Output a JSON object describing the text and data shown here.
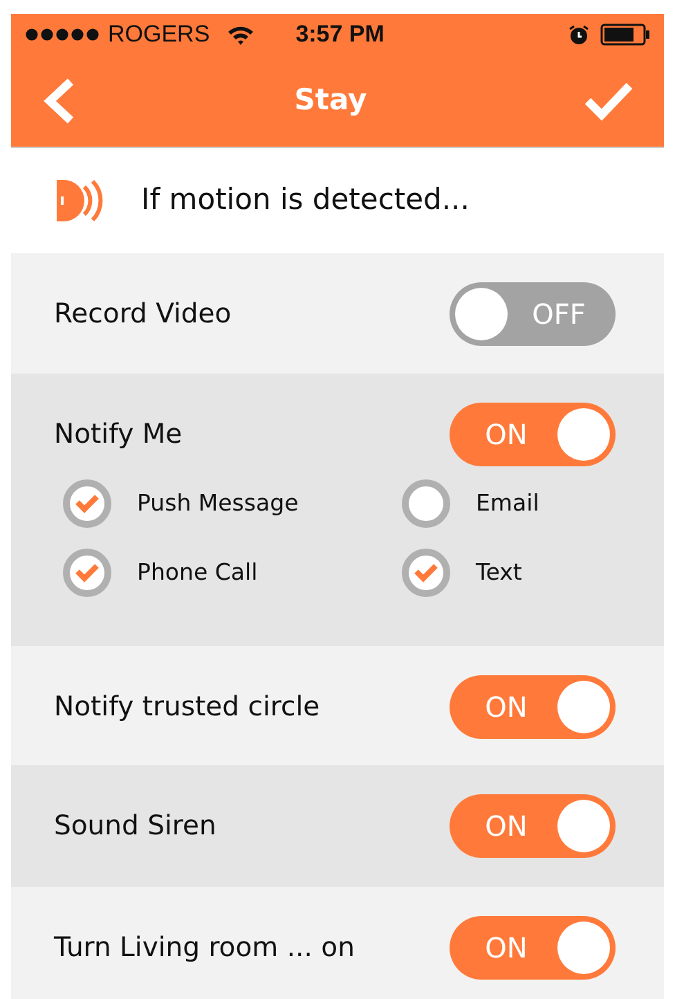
{
  "status_bar": {
    "carrier": "ROGERS",
    "time": "3:57 PM"
  },
  "nav_bar": {
    "title": "Stay"
  },
  "header": {
    "text": "If motion is detected..."
  },
  "settings": [
    {
      "label": "Record Video",
      "on": false,
      "toggle_text": "OFF"
    },
    {
      "label": "Notify Me",
      "on": true,
      "toggle_text": "ON",
      "options": [
        {
          "label": "Push Message",
          "checked": true
        },
        {
          "label": "Email",
          "checked": false
        },
        {
          "label": "Phone Call",
          "checked": true
        },
        {
          "label": "Text",
          "checked": true
        }
      ]
    },
    {
      "label": "Notify trusted circle",
      "on": true,
      "toggle_text": "ON"
    },
    {
      "label": "Sound Siren",
      "on": true,
      "toggle_text": "ON"
    },
    {
      "label": "Turn Living room ... on",
      "on": true,
      "toggle_text": "ON"
    }
  ]
}
